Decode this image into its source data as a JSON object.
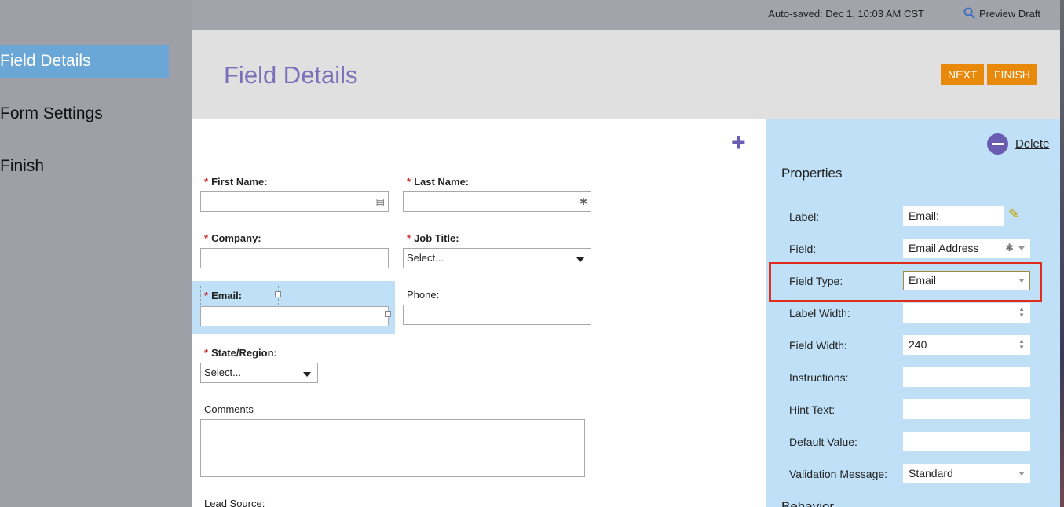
{
  "sidebar": {
    "items": [
      {
        "label": "Field Details",
        "active": true
      },
      {
        "label": "Form Settings",
        "active": false
      },
      {
        "label": "Finish",
        "active": false
      }
    ]
  },
  "topbar": {
    "autosave": "Auto-saved: Dec 1, 10:03 AM CST",
    "preview_label": "Preview Draft"
  },
  "header": {
    "title": "Field Details",
    "next_label": "NEXT",
    "finish_label": "FINISH"
  },
  "form": {
    "first_name_label": "First Name:",
    "last_name_label": "Last Name:",
    "company_label": "Company:",
    "job_title_label": "Job Title:",
    "job_title_value": "Select...",
    "email_label": "Email:",
    "phone_label": "Phone:",
    "state_label": "State/Region:",
    "state_value": "Select...",
    "comments_label": "Comments",
    "lead_source_label": "Lead Source:"
  },
  "properties": {
    "title": "Properties",
    "delete_label": "Delete",
    "label_label": "Label:",
    "label_value": "Email:",
    "field_label": "Field:",
    "field_value": "Email Address",
    "field_type_label": "Field Type:",
    "field_type_value": "Email",
    "label_width_label": "Label Width:",
    "label_width_value": "",
    "field_width_label": "Field Width:",
    "field_width_value": "240",
    "instructions_label": "Instructions:",
    "hint_text_label": "Hint Text:",
    "default_value_label": "Default Value:",
    "validation_message_label": "Validation Message:",
    "validation_message_value": "Standard",
    "behavior_title": "Behavior"
  },
  "colors": {
    "accent_orange": "#e8890c",
    "title_purple": "#7b6fb9",
    "panel_blue": "#bfe0f6",
    "callout_red": "#e02c1a",
    "active_nav": "#6aa6d6"
  }
}
